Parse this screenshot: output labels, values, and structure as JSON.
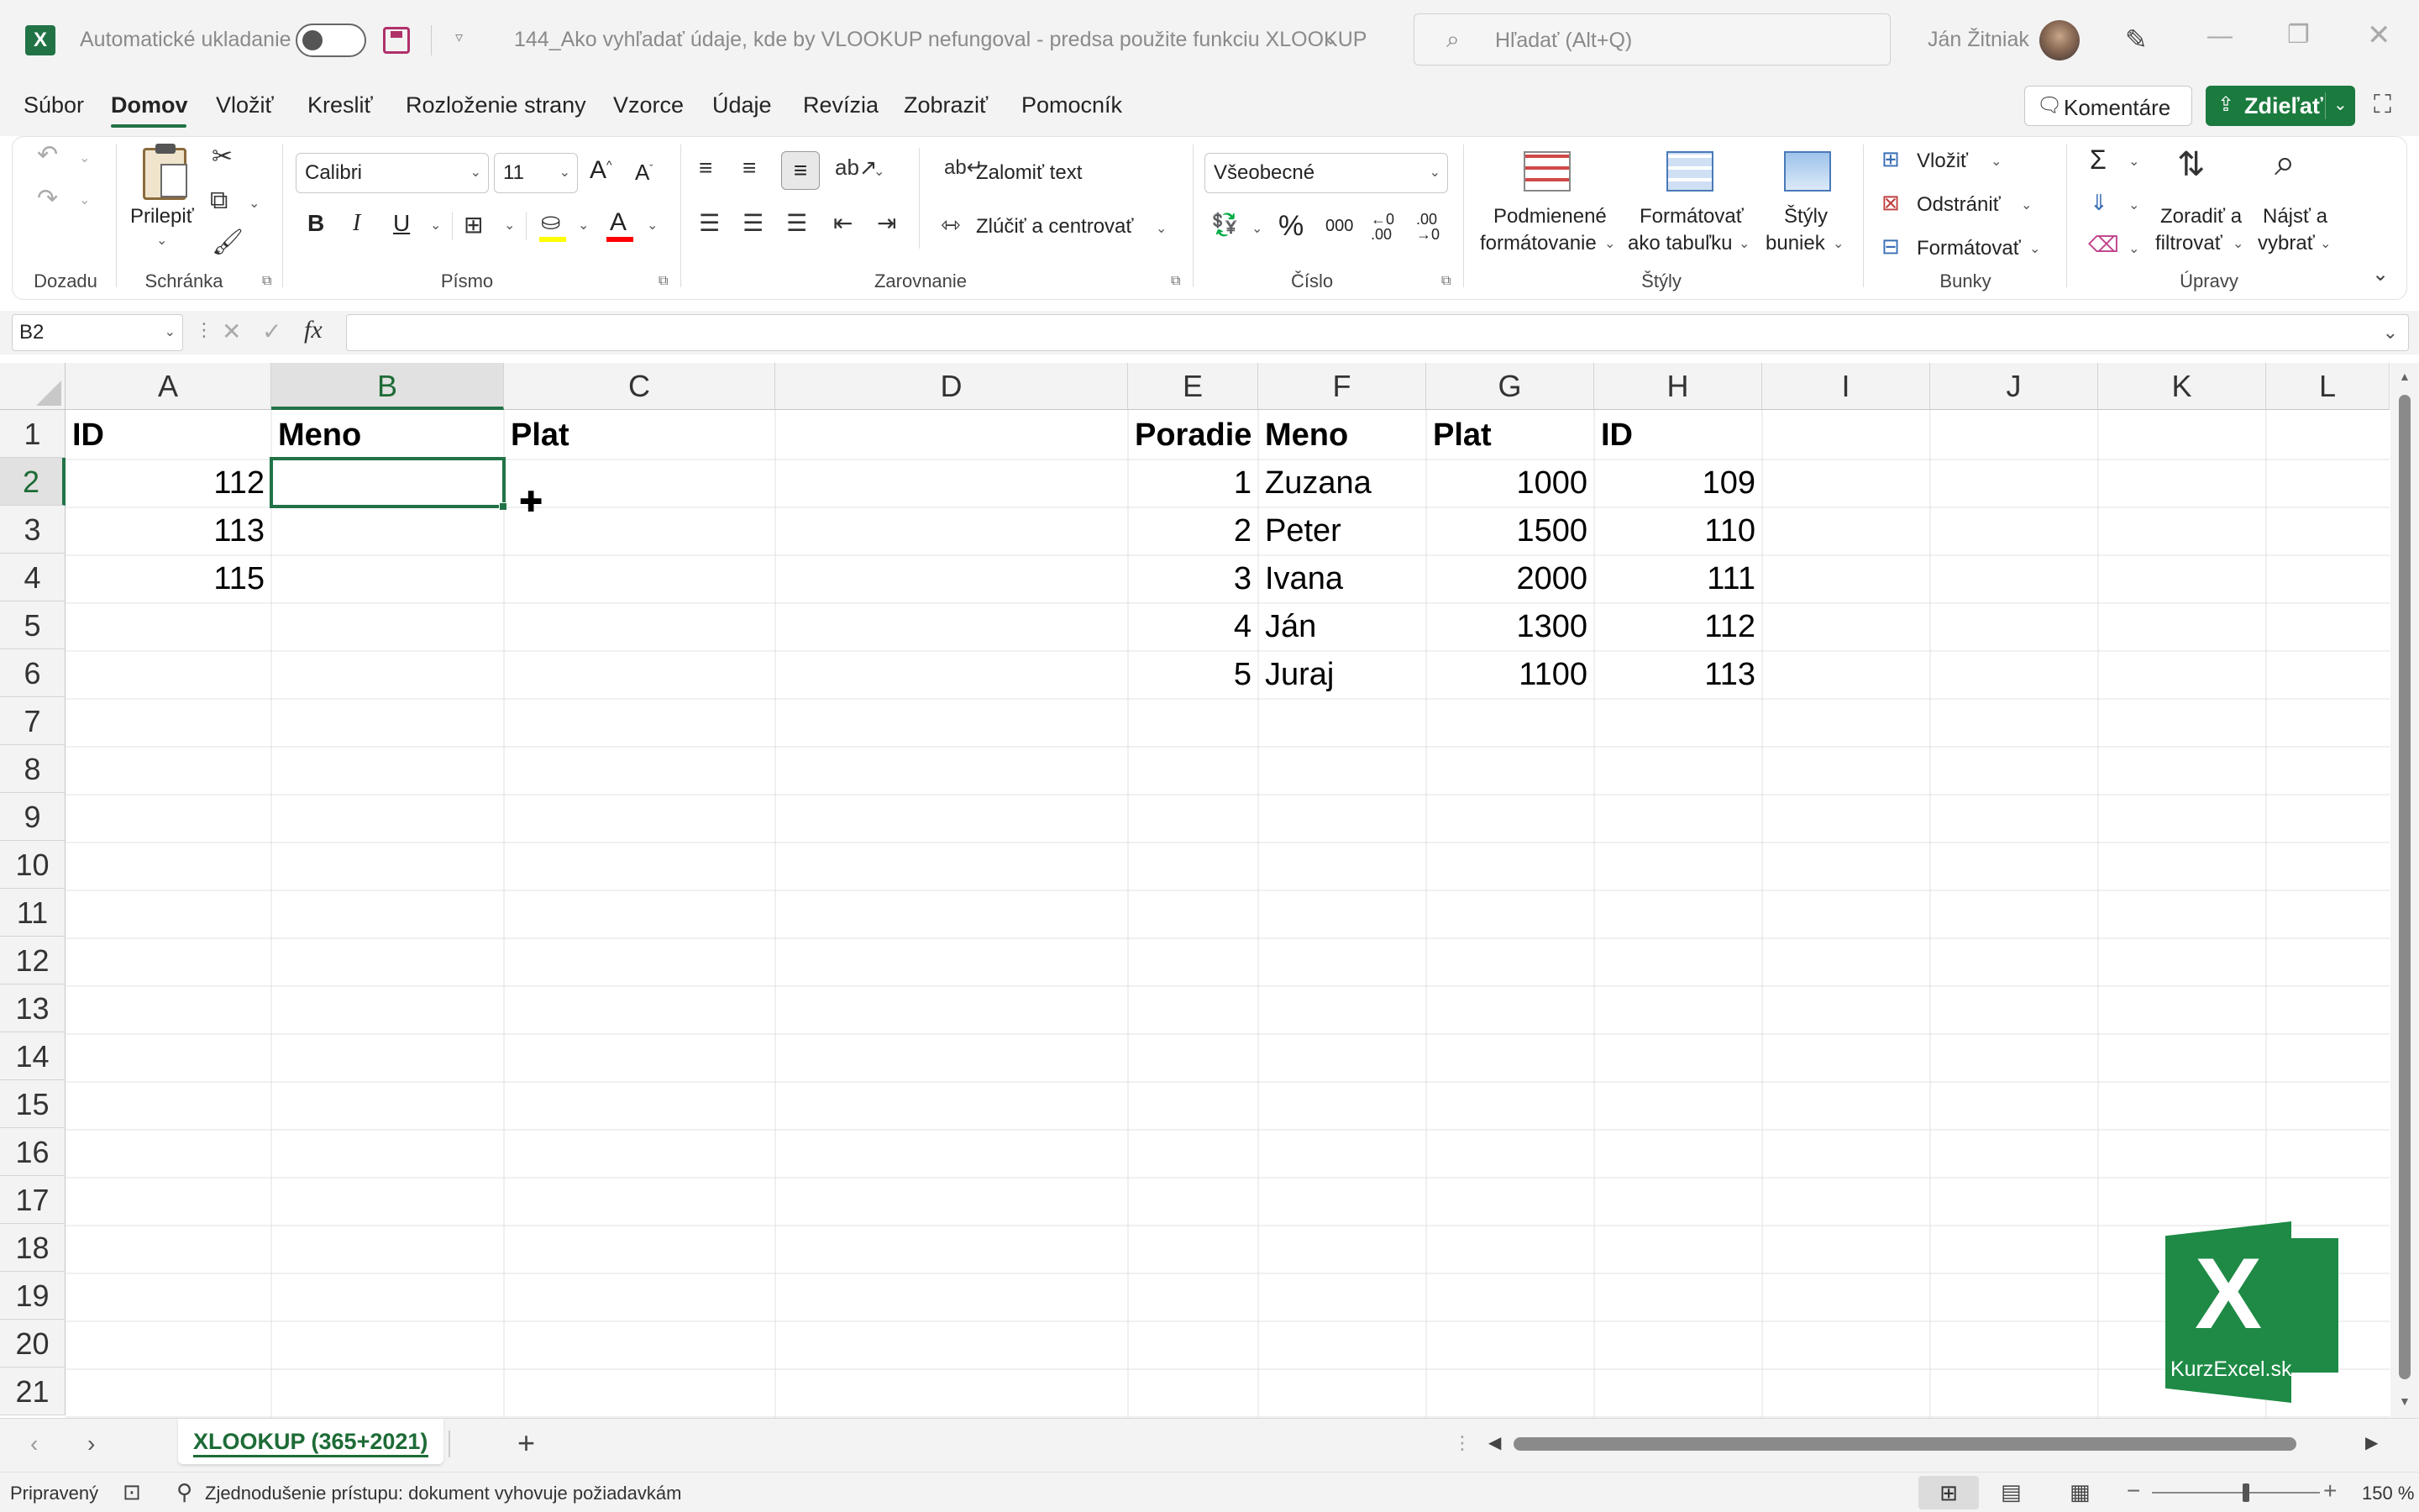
{
  "titlebar": {
    "autosave_label": "Automatické ukladanie",
    "doc_title": "144_Ako vyhľadať údaje, kde by VLOOKUP nefungoval - predsa použite funkciu XLOOKUP",
    "search_placeholder": "Hľadať (Alt+Q)",
    "user_name": "Ján Žitniak"
  },
  "menu": {
    "items": [
      "Súbor",
      "Domov",
      "Vložiť",
      "Kresliť",
      "Rozloženie strany",
      "Vzorce",
      "Údaje",
      "Revízia",
      "Zobraziť",
      "Pomocník"
    ],
    "active": "Domov",
    "comments_label": "Komentáre",
    "share_label": "Zdieľať"
  },
  "ribbon": {
    "groups": {
      "undo": "Dozadu",
      "clipboard": "Schránka",
      "font": "Písmo",
      "alignment": "Zarovnanie",
      "number": "Číslo",
      "styles": "Štýly",
      "cells": "Bunky",
      "editing": "Úpravy"
    },
    "paste_label": "Prilepiť",
    "font_name": "Calibri",
    "font_size": "11",
    "wrap_text": "Zalomiť text",
    "merge_center": "Zlúčiť a centrovať",
    "number_format": "Všeobecné",
    "conditional_line1": "Podmienené",
    "conditional_line2": "formátovanie",
    "format_table_line1": "Formátovať",
    "format_table_line2": "ako tabuľku",
    "cell_styles_line1": "Štýly",
    "cell_styles_line2": "buniek",
    "insert": "Vložiť",
    "delete": "Odstrániť",
    "format": "Formátovať",
    "sort_line1": "Zoradiť a",
    "sort_line2": "filtrovať",
    "find_line1": "Nájsť a",
    "find_line2": "vybrať",
    "colors": {
      "fill_color": "#ffff00",
      "font_color": "#ff0000"
    }
  },
  "formula_bar": {
    "name_box": "B2",
    "formula": ""
  },
  "sheet": {
    "columns": [
      "A",
      "B",
      "C",
      "D",
      "E",
      "F",
      "G",
      "H",
      "I",
      "J",
      "K",
      "L"
    ],
    "selected_column": "B",
    "rows": [
      "1",
      "2",
      "3",
      "4",
      "5",
      "6",
      "7",
      "8",
      "9",
      "10",
      "11",
      "12",
      "13",
      "14",
      "15",
      "16",
      "17",
      "18",
      "19",
      "20",
      "21"
    ],
    "selected_row": "2",
    "left_table": {
      "headers": [
        "ID",
        "Meno",
        "Plat"
      ],
      "ids": [
        "112",
        "113",
        "115"
      ]
    },
    "right_table": {
      "headers": [
        "Poradie",
        "Meno",
        "Plat",
        "ID"
      ],
      "rows": [
        [
          "1",
          "Zuzana",
          "1000",
          "109"
        ],
        [
          "2",
          "Peter",
          "1500",
          "110"
        ],
        [
          "3",
          "Ivana",
          "2000",
          "111"
        ],
        [
          "4",
          "Ján",
          "1300",
          "112"
        ],
        [
          "5",
          "Juraj",
          "1100",
          "113"
        ]
      ]
    },
    "watermark_text": "KurzExcel.sk"
  },
  "tabs": {
    "active_sheet": "XLOOKUP (365+2021)"
  },
  "status": {
    "ready": "Pripravený",
    "accessibility": "Zjednodušenie prístupu: dokument vyhovuje požiadavkám",
    "zoom": "150 %"
  },
  "colors": {
    "excel_green": "#217346",
    "share_green": "#1b7a3e",
    "selection_green": "#1d6b36"
  }
}
